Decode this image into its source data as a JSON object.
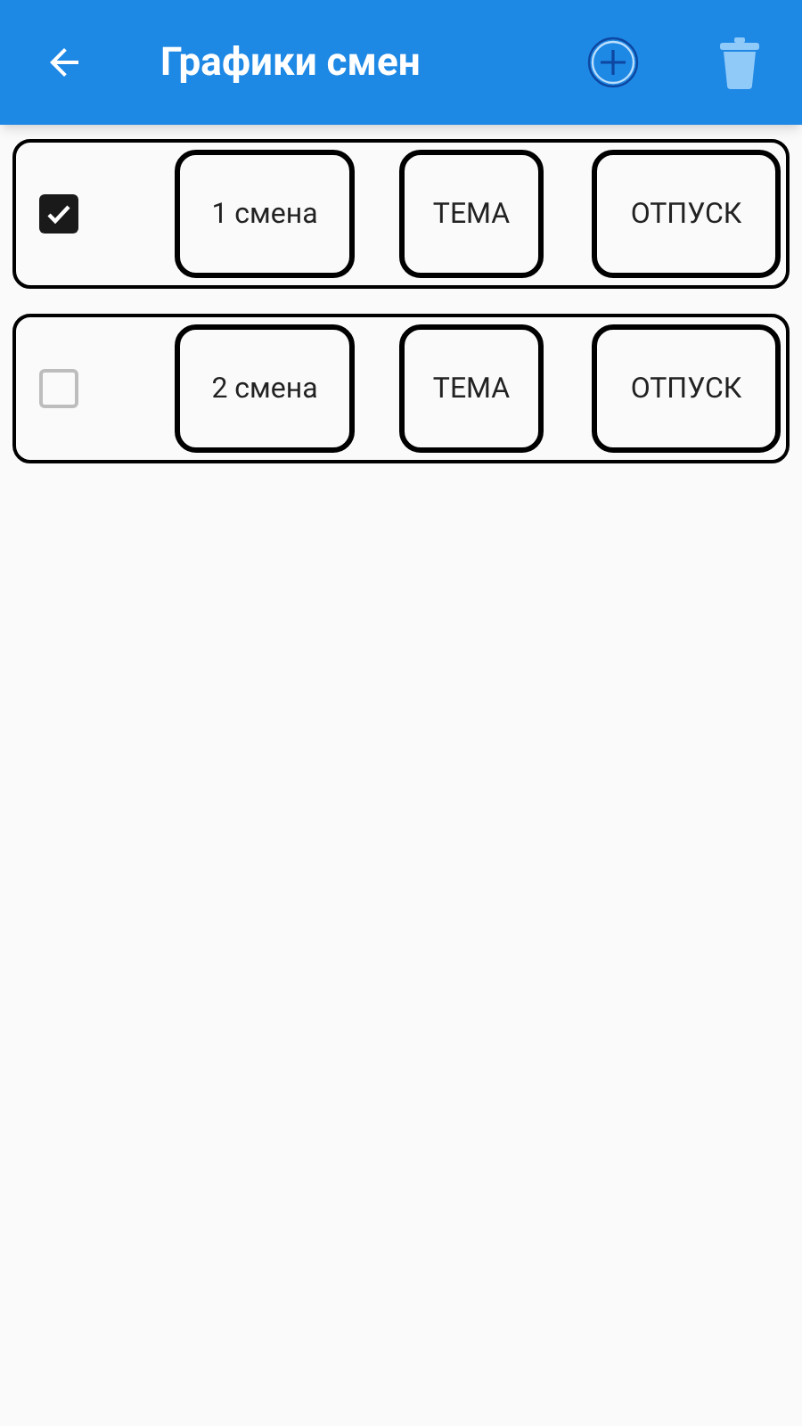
{
  "app_bar": {
    "title": "Графики смен"
  },
  "shifts": [
    {
      "checked": true,
      "name": "1 смена",
      "theme": "ТЕМА",
      "vacation": "ОТПУСК"
    },
    {
      "checked": false,
      "name": "2 смена",
      "theme": "ТЕМА",
      "vacation": "ОТПУСК"
    }
  ]
}
